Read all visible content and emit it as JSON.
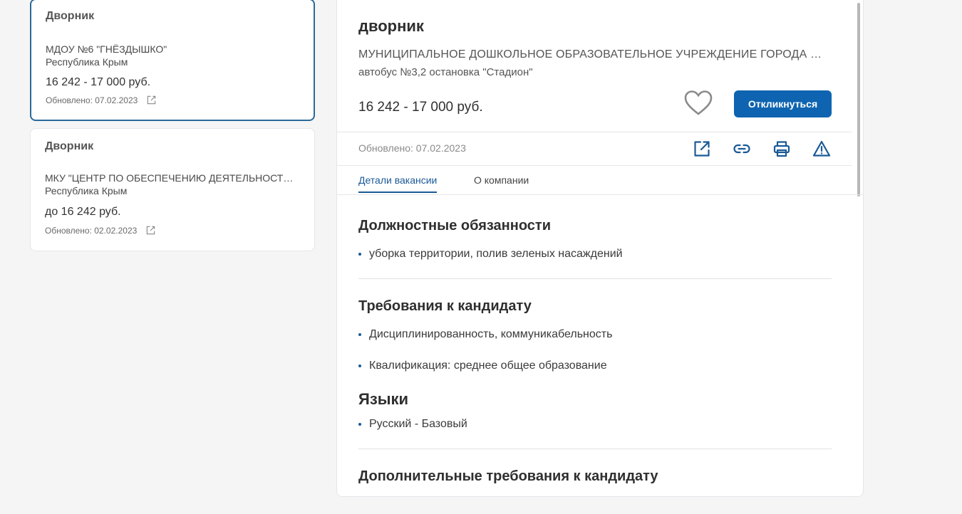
{
  "vacancy_list": [
    {
      "title": "Дворник",
      "org": "МДОУ №6 \"ГНЁЗДЫШКО\"",
      "region": "Республика Крым",
      "salary": "16 242 - 17 000 руб.",
      "updated": "Обновлено: 07.02.2023"
    },
    {
      "title": "Дворник",
      "org": "МКУ \"ЦЕНТР ПО ОБЕСПЕЧЕНИЮ ДЕЯТЕЛЬНОСТИ МУНИЦИПАЛЬНЫХ УЧРЕЖДЕНИЙ\"",
      "region": "Республика Крым",
      "salary": "до 16 242 руб.",
      "updated": "Обновлено: 02.02.2023"
    }
  ],
  "detail": {
    "title": "дворник",
    "org": "МУНИЦИПАЛЬНОЕ ДОШКОЛЬНОЕ ОБРАЗОВАТЕЛЬНОЕ УЧРЕЖДЕНИЕ ГОРОДА ДЖАНКОЯ РЕСПУБЛИКИ КРЫМ",
    "address": "автобус №3,2 остановка \"Стадион\"",
    "salary": "16 242 - 17 000 руб.",
    "apply_label": "Откликнуться",
    "updated": "Обновлено: 07.02.2023",
    "tabs": [
      "Детали вакансии",
      "О компании"
    ],
    "sections": {
      "duties_title": "Должностные обязанности",
      "duties": [
        "уборка территории, полив зеленых насаждений"
      ],
      "requirements_title": "Требования к кандидату",
      "requirements": [
        "Дисциплинированность, коммуникабельность",
        "Квалификация: среднее общее образование"
      ],
      "languages_title": "Языки",
      "languages": [
        "Русский - Базовый"
      ],
      "additional_title": "Дополнительные требования к кандидату"
    }
  },
  "icons": {
    "card_external": "external-link-icon",
    "favorite": "heart-icon",
    "open": "external-link-icon",
    "link": "link-icon",
    "print": "printer-icon",
    "report": "warning-icon"
  },
  "colors": {
    "accent": "#0e64b0",
    "active_border": "#2a6a9a",
    "background": "#f5f5f5"
  }
}
